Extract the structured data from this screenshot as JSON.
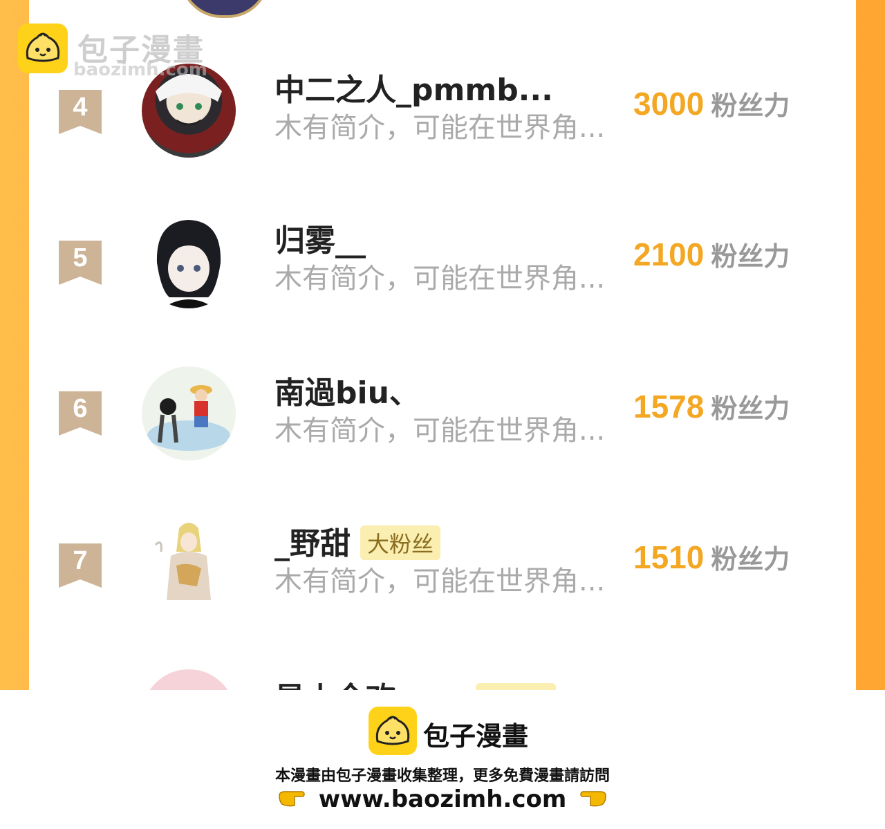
{
  "watermark": {
    "title": "包子漫畫",
    "url": "baozimh.com"
  },
  "fans_unit": "粉丝力",
  "rows": [
    {
      "rank": "4",
      "name": "中二之人_pmmb...",
      "badge": "",
      "bio": "木有简介，可能在世界角...",
      "fans": "3000"
    },
    {
      "rank": "5",
      "name": "归雾__",
      "badge": "",
      "bio": "木有简介，可能在世界角...",
      "fans": "2100"
    },
    {
      "rank": "6",
      "name": "南過biu、",
      "badge": "",
      "bio": "木有简介，可能在世界角...",
      "fans": "1578"
    },
    {
      "rank": "7",
      "name": "_野甜",
      "badge": "大粉丝",
      "bio": "木有简介，可能在世界角...",
      "fans": "1510"
    }
  ],
  "cut_row": {
    "name": "星小全欢",
    "badge": "大粉丝"
  },
  "footer": {
    "brand": "包子漫畫",
    "notice": "本漫畫由包子漫畫收集整理，更多免費漫畫請訪問",
    "url": "www.baozimh.com"
  },
  "colors": {
    "accent": "#f3a723",
    "frame": "#ffa632",
    "badge_bg": "#fbeeb1",
    "logo": "#ffd21a"
  }
}
